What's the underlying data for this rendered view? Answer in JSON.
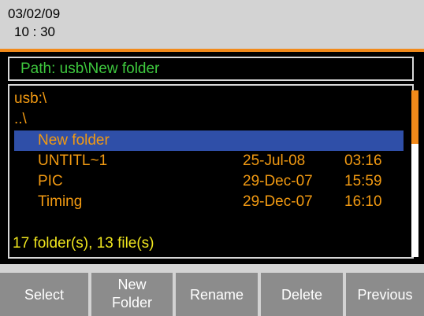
{
  "header": {
    "date": "03/02/09",
    "time": "10 : 30"
  },
  "path_bar": {
    "label": "Path: usb\\New folder"
  },
  "file_list": {
    "rows": [
      {
        "name": "usb:\\",
        "date": "",
        "time": ""
      },
      {
        "name": "..\\",
        "date": "",
        "time": ""
      },
      {
        "name": "New folder",
        "date": "",
        "time": "",
        "selected": true
      },
      {
        "name": "UNTITL~1",
        "date": "25-Jul-08",
        "time": "03:16"
      },
      {
        "name": "PIC",
        "date": "29-Dec-07",
        "time": "15:59"
      },
      {
        "name": "Timing",
        "date": "29-Dec-07",
        "time": "16:10"
      }
    ],
    "status": "17 folder(s), 13 file(s)"
  },
  "softkeys": {
    "select": "Select",
    "new_folder_line1": "New",
    "new_folder_line2": "Folder",
    "rename": "Rename",
    "delete": "Delete",
    "previous": "Previous"
  },
  "colors": {
    "accent_orange": "#f28a1a",
    "list_text": "#f29a12",
    "path_text": "#3ec83e",
    "status_text": "#f0e61e",
    "selection": "#2f4fa8",
    "softkey_bg": "#8c8c8c"
  }
}
